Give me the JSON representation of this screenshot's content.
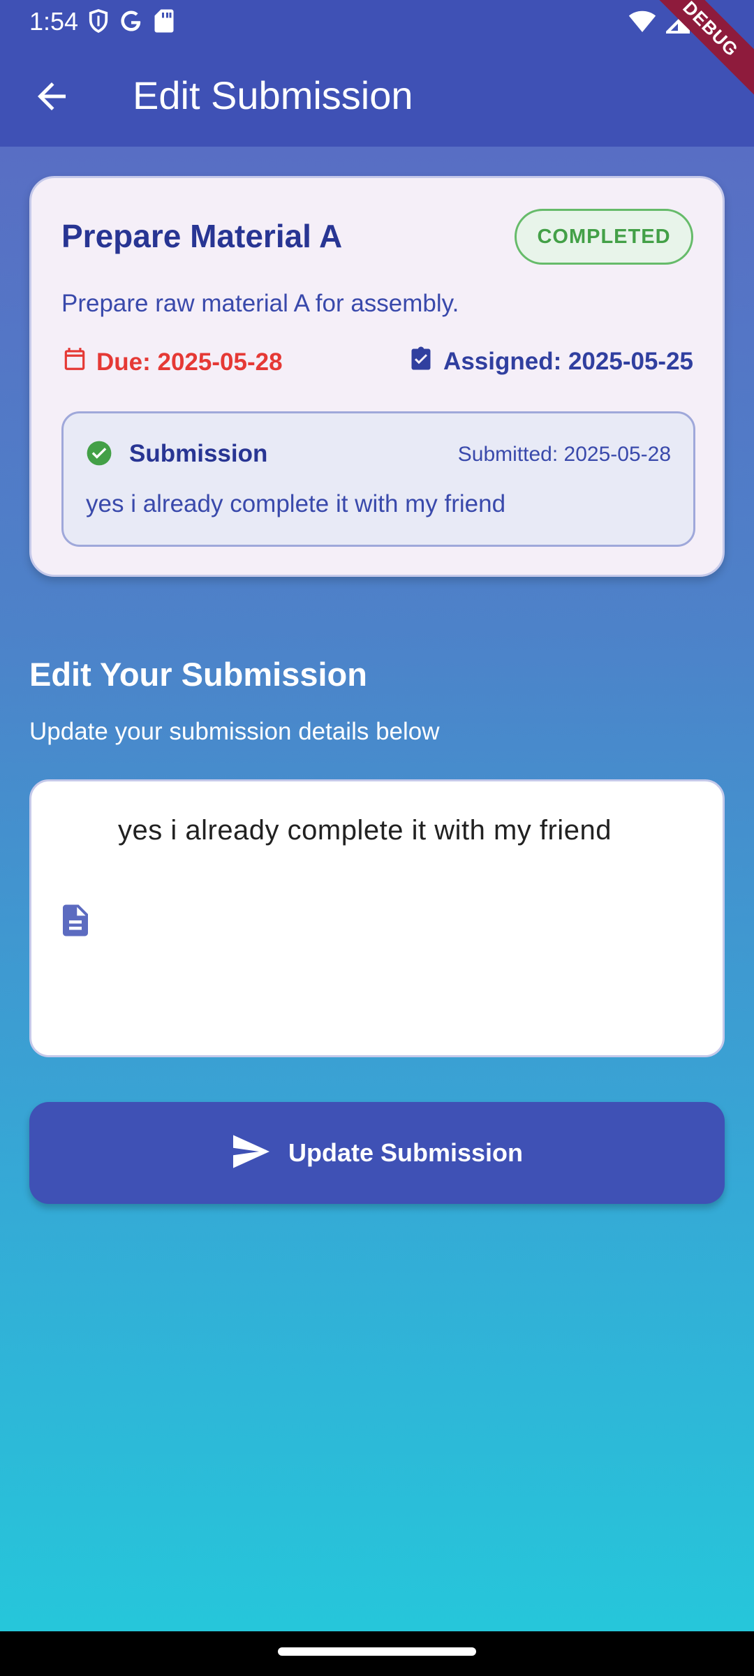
{
  "status_bar": {
    "time": "1:54",
    "left_icons": [
      "shield-icon",
      "google-icon",
      "sd-card-icon"
    ],
    "right_icons": [
      "wifi-icon",
      "signal-icon",
      "battery-icon"
    ]
  },
  "app_bar": {
    "title": "Edit Submission",
    "debug_banner": "DEBUG",
    "color": "#3f51b5"
  },
  "task": {
    "title": "Prepare Material A",
    "status": "COMPLETED",
    "status_color": "#43a047",
    "description": "Prepare raw material A for assembly.",
    "due": "Due: 2025-05-28",
    "due_color": "#e53935",
    "assigned": "Assigned: 2025-05-25",
    "submission": {
      "label": "Submission",
      "submitted": "Submitted: 2025-05-28",
      "text": "yes i already complete it with my friend"
    }
  },
  "edit": {
    "heading": "Edit Your Submission",
    "subheading": "Update your submission details below",
    "field_value": "yes i already complete it with my friend",
    "button_label": "Update Submission"
  }
}
